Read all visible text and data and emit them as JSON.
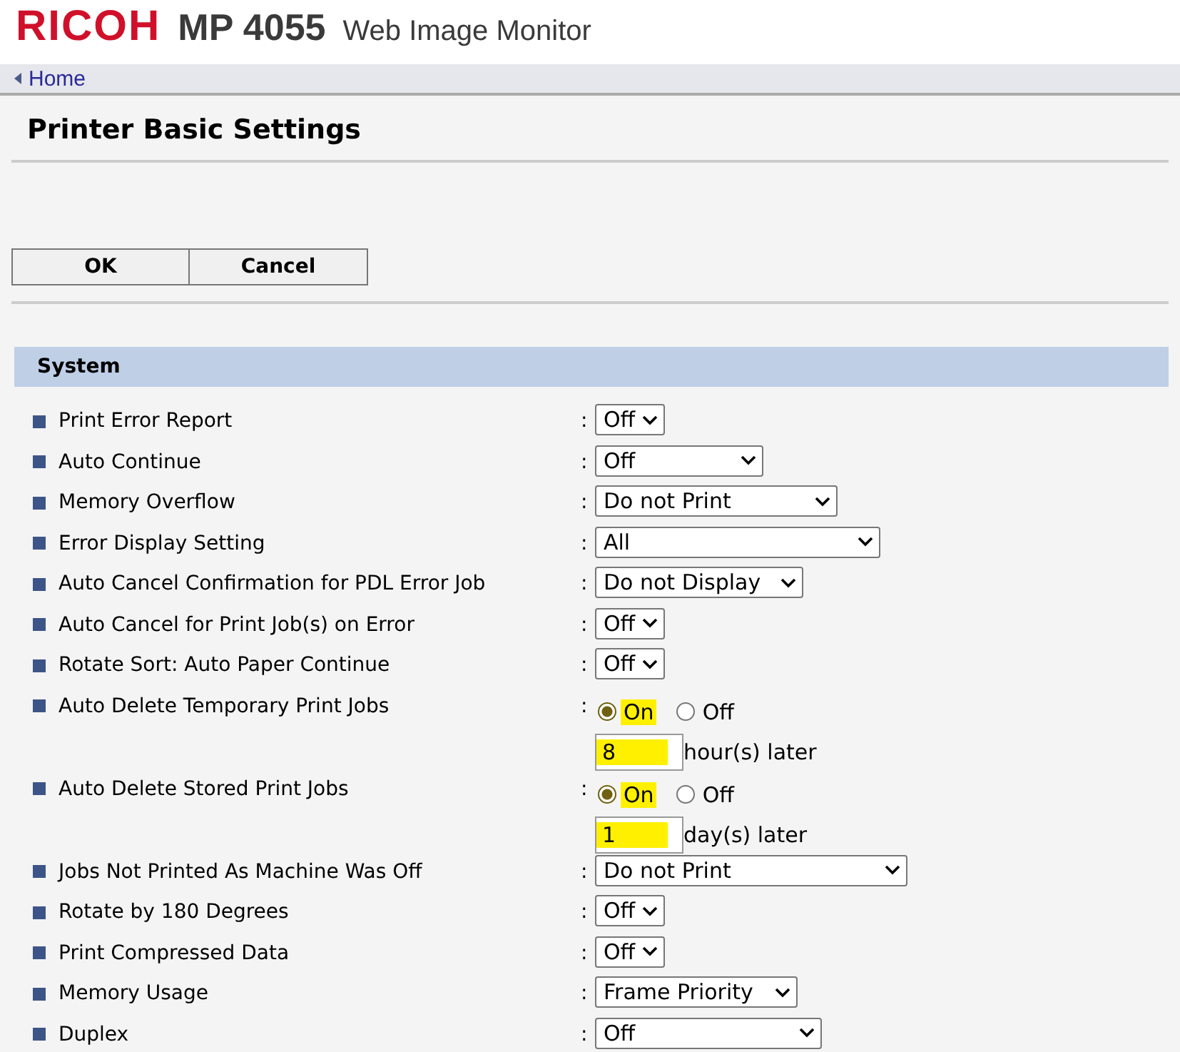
{
  "header": {
    "brand": "RICOH",
    "model": "MP 4055",
    "product": "Web Image Monitor"
  },
  "breadcrumb": {
    "link": "Home"
  },
  "page_title": "Printer Basic Settings",
  "buttons": [
    "OK",
    "Cancel"
  ],
  "section": {
    "title": "System",
    "rows": [
      {
        "kind": "select",
        "label": "Print Error Report",
        "separator": ":",
        "value": "Off"
      },
      {
        "kind": "select",
        "label": "Auto Continue",
        "separator": ":",
        "value": "Off"
      },
      {
        "kind": "select",
        "label": "Memory Overflow",
        "separator": ":",
        "value": "Do not Print"
      },
      {
        "kind": "select",
        "label": "Error Display Setting",
        "separator": ":",
        "value": "All"
      },
      {
        "kind": "select",
        "label": "Auto Cancel Confirmation for PDL Error Job",
        "separator": ":",
        "value": "Do not Display"
      },
      {
        "kind": "select",
        "label": "Auto Cancel for Print Job(s) on Error",
        "separator": ":",
        "value": "Off"
      },
      {
        "kind": "select",
        "label": "Rotate Sort: Auto Paper Continue",
        "separator": ":",
        "value": "Off"
      },
      {
        "kind": "radio",
        "label": "Auto Delete Temporary Print Jobs",
        "separator": ":",
        "options": [
          {
            "label": "On",
            "selected": true,
            "highlighted": true
          },
          {
            "label": "Off",
            "selected": false,
            "highlighted": false
          }
        ],
        "field": {
          "value": "8",
          "unit": "hour(s) later",
          "highlighted": true
        }
      },
      {
        "kind": "radio",
        "label": "Auto Delete Stored Print Jobs",
        "separator": ":",
        "options": [
          {
            "label": "On",
            "selected": true,
            "highlighted": true
          },
          {
            "label": "Off",
            "selected": false,
            "highlighted": false
          }
        ],
        "field": {
          "value": "1",
          "unit": "day(s) later",
          "highlighted": true
        }
      },
      {
        "kind": "select",
        "label": "Jobs Not Printed As Machine Was Off",
        "separator": ":",
        "value": "Do not Print"
      },
      {
        "kind": "select",
        "label": "Rotate by 180 Degrees",
        "separator": ":",
        "value": "Off"
      },
      {
        "kind": "select",
        "label": "Print Compressed Data",
        "separator": ":",
        "value": "Off"
      },
      {
        "kind": "select",
        "label": "Memory Usage",
        "separator": ":",
        "value": "Frame Priority"
      },
      {
        "kind": "select",
        "label": "Duplex",
        "separator": ":",
        "value": "Off"
      }
    ]
  }
}
